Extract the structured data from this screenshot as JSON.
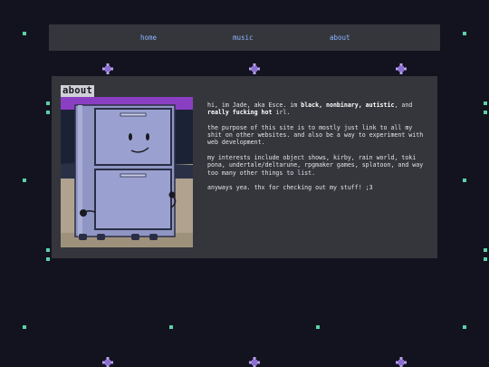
{
  "nav": {
    "items": [
      {
        "label": "home"
      },
      {
        "label": "music"
      },
      {
        "label": "about"
      }
    ]
  },
  "about": {
    "heading": "about",
    "photo_alt": "Filing cabinet character from an object show",
    "bio": {
      "p1_start": "hi, im Jade, aka Esce. im ",
      "p1_bold1": "black, nonbinary, autistic",
      "p1_mid": ", and ",
      "p1_bold2": "really fucking hot",
      "p1_end": " irl.",
      "p2": "the purpose of this site is to mostly just link to all my shit on other websites. and also be a way to experiment with web development.",
      "p3": "my interests include object shows, kirby, rain world, toki pona, undertale/deltarune, rpgmaker games, splatoon, and way too many other things to list.",
      "p4": "anyways yea. thx for checking out my stuff! ;3"
    }
  },
  "colors": {
    "background": "#13131f",
    "panel": "#34363c",
    "link": "#8fb4ff",
    "star_teal": "#5ad1a8",
    "star_purple": "#b9a0f0"
  },
  "decor_icons": [
    "teal-star-icon",
    "purple-star-icon"
  ]
}
